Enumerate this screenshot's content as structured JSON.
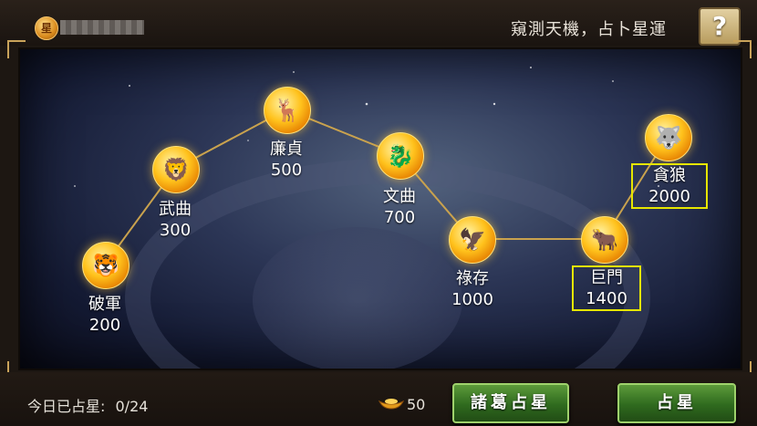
{
  "header": {
    "avatar_glyph": "星",
    "slogan": "窺測天機，占卜星運",
    "help_label": "?"
  },
  "stars": [
    {
      "name": "破軍",
      "cost": "200",
      "highlighted": false
    },
    {
      "name": "武曲",
      "cost": "300",
      "highlighted": false
    },
    {
      "name": "廉貞",
      "cost": "500",
      "highlighted": false
    },
    {
      "name": "文曲",
      "cost": "700",
      "highlighted": false
    },
    {
      "name": "祿存",
      "cost": "1000",
      "highlighted": false
    },
    {
      "name": "巨門",
      "cost": "1400",
      "highlighted": true
    },
    {
      "name": "貪狼",
      "cost": "2000",
      "highlighted": true
    }
  ],
  "footer": {
    "today_label": "今日已占星:",
    "today_count": "0/24",
    "ingot_cost": "50",
    "zhuge_button": "諸葛占星",
    "divine_button": "占星"
  },
  "colors": {
    "highlight": "#e6e600",
    "button_green": "#2f6a1e"
  }
}
